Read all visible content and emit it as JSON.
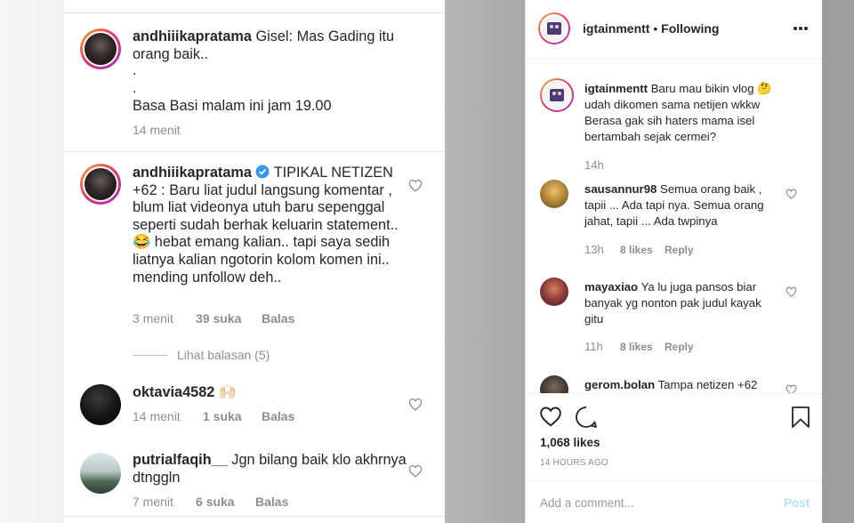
{
  "left_comments": [
    {
      "username": "andhiiikapratama",
      "text": "Gisel: Mas Gading itu orang baik..",
      "dots": [
        ".",
        "."
      ],
      "extra": "Basa Basi malam ini jam 19.00",
      "time": "14 menit"
    },
    {
      "username": "andhiiikapratama",
      "verified": true,
      "text": "TIPIKAL NETIZEN +62 : Baru liat judul langsung komentar , blum liat videonya utuh baru sepenggal seperti sudah berhak keluarin statement.. 😂 hebat emang kalian.. tapi saya sedih liatnya kalian ngotorin kolom komen ini.. mending unfollow deh..",
      "time": "3 menit",
      "likes": "39 suka",
      "reply": "Balas",
      "view_replies": "Lihat balasan (5)"
    },
    {
      "username": "oktavia4582",
      "text": "🙌🏻",
      "time": "14 menit",
      "likes": "1 suka",
      "reply": "Balas"
    },
    {
      "username": "putrialfaqih__",
      "text": "Jgn bilang baik klo akhrnya dtnggln",
      "time": "7 menit",
      "likes": "6 suka",
      "reply": "Balas"
    }
  ],
  "post_header": {
    "username": "igtainmentt",
    "separator": "•",
    "follow_status": "Following",
    "more_icon": "more-icon"
  },
  "caption": {
    "username": "igtainmentt",
    "text": "Baru mau bikin vlog 🤔 udah dikomen sama netijen wkkw Berasa gak sih haters mama isel bertambah sejak cermei?",
    "time": "14h"
  },
  "right_comments": [
    {
      "username": "sausannur98",
      "text": "Semua orang baik , tapii ... Ada tapi nya. Semua orang jahat, tapii ... Ada twpinya",
      "time": "13h",
      "likes": "8 likes",
      "reply": "Reply"
    },
    {
      "username": "mayaxiao",
      "text": "Ya lu juga pansos biar banyak yg nonton pak judul kayak gitu",
      "time": "11h",
      "likes": "8 likes",
      "reply": "Reply"
    },
    {
      "username": "gerom.bolan",
      "text": "Tampa netizen +62"
    }
  ],
  "actions": {
    "likes_count": "1,068 likes",
    "timestamp": "14 HOURS AGO"
  },
  "comment_box": {
    "placeholder": "Add a comment...",
    "post_label": "Post"
  },
  "colors": {
    "verified": "#3897f0",
    "post_disabled": "#b2dffc",
    "ring": "#e2336b"
  }
}
